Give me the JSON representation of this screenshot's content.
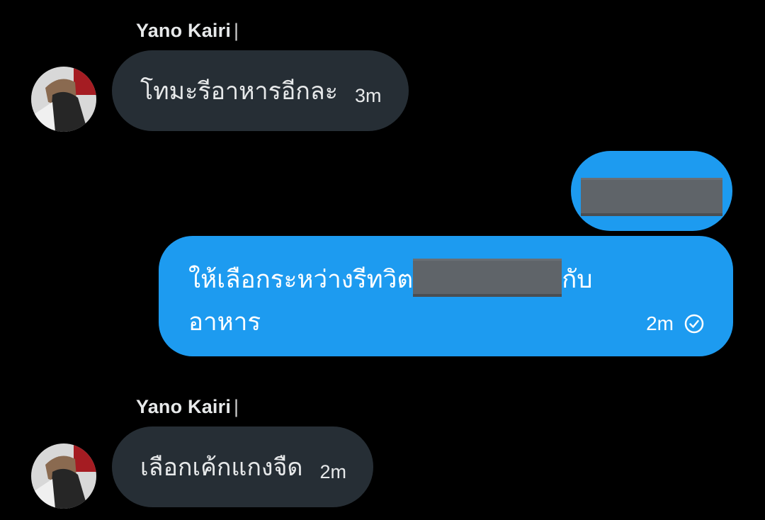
{
  "colors": {
    "background": "#000000",
    "incoming_bubble": "#262e35",
    "outgoing_bubble": "#1d9bf0",
    "redaction": "#5f6469"
  },
  "messages": [
    {
      "direction": "incoming",
      "sender": "Yano Kairi",
      "separator": "|",
      "text": "โทมะรีอาหารอีกละ",
      "time": "3m"
    },
    {
      "direction": "outgoing",
      "redacted": true
    },
    {
      "direction": "outgoing",
      "text_line1_before": "ให้เลือกระหว่างรีทวิต",
      "text_line1_after": "กับ",
      "text_line2": "อาหาร",
      "time": "2m",
      "status_icon": "check-circle-icon"
    },
    {
      "direction": "incoming",
      "sender": "Yano Kairi",
      "separator": "|",
      "text": "เลือกเค้กแกงจืด",
      "time": "2m"
    }
  ]
}
